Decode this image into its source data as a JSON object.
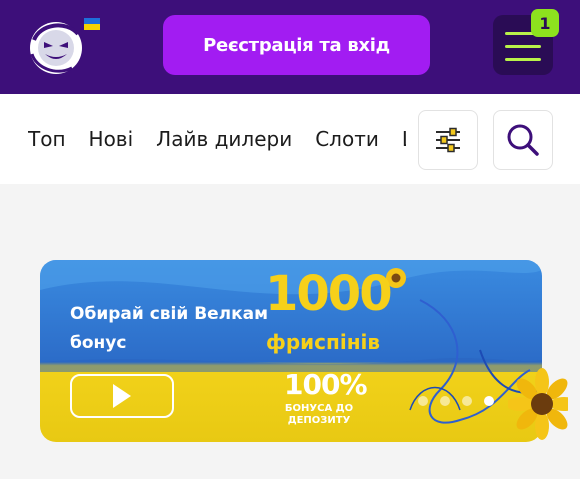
{
  "header": {
    "register_label": "Реєстрація та вхід",
    "menu_badge": "1",
    "colors": {
      "background": "#3d0f7a",
      "register": "#a21cf2",
      "badge": "#8de21e"
    },
    "icons": [
      "logo-icon",
      "ukraine-flag-icon",
      "hamburger-menu-icon"
    ]
  },
  "nav": {
    "items": [
      "Топ",
      "Нові",
      "Лайв дилери",
      "Слоти",
      "Ц"
    ],
    "icons": [
      "filter-sliders-icon",
      "search-icon"
    ]
  },
  "banner": {
    "title": "Обирай свій Велкам бонус",
    "promo_number": "1000",
    "promo_unit": "фриспінів",
    "bonus_percent": "100%",
    "bonus_text": "БОНУСА ДО ДЕПОЗИТУ",
    "slides": 4,
    "active_slide": 4,
    "icons": [
      "play-icon",
      "sunflower-icon"
    ]
  }
}
